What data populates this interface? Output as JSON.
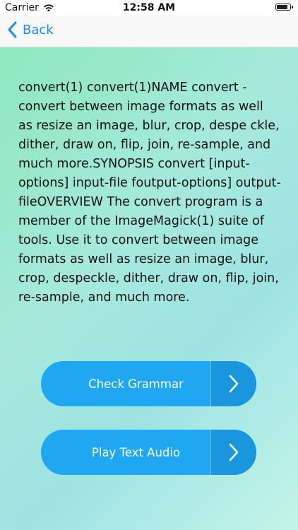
{
  "status_bar": {
    "carrier": "Carrier",
    "time": "12:58 AM",
    "battery_level": 0.9
  },
  "nav": {
    "back_label": "Back"
  },
  "body_text": "convert(1) convert(1)NAME convert - convert between image formats as well as resize an image, blur, crop, despe ckle, dither, draw on, flip, join, re-sample, and much more.SYNOPSIS convert [input-options] input-file foutput-options] output-fileOVERVIEW The convert program is a member of the ImageMagick(1) suite of tools. Use it to convert between image formats as well as resize an image, blur, crop, despeckle, dither, draw on, flip, join, re-sample, and much more.",
  "buttons": {
    "check_grammar": "Check Grammar",
    "play_audio": "Play Text Audio"
  },
  "colors": {
    "accent": "#1e88f5",
    "button": "#1fa7f1",
    "gradient_start": "#8ee8bd",
    "gradient_end": "#c3f4ea"
  },
  "icons": [
    "wifi-icon",
    "battery-icon",
    "back-chevron-icon",
    "chevron-right-icon"
  ]
}
